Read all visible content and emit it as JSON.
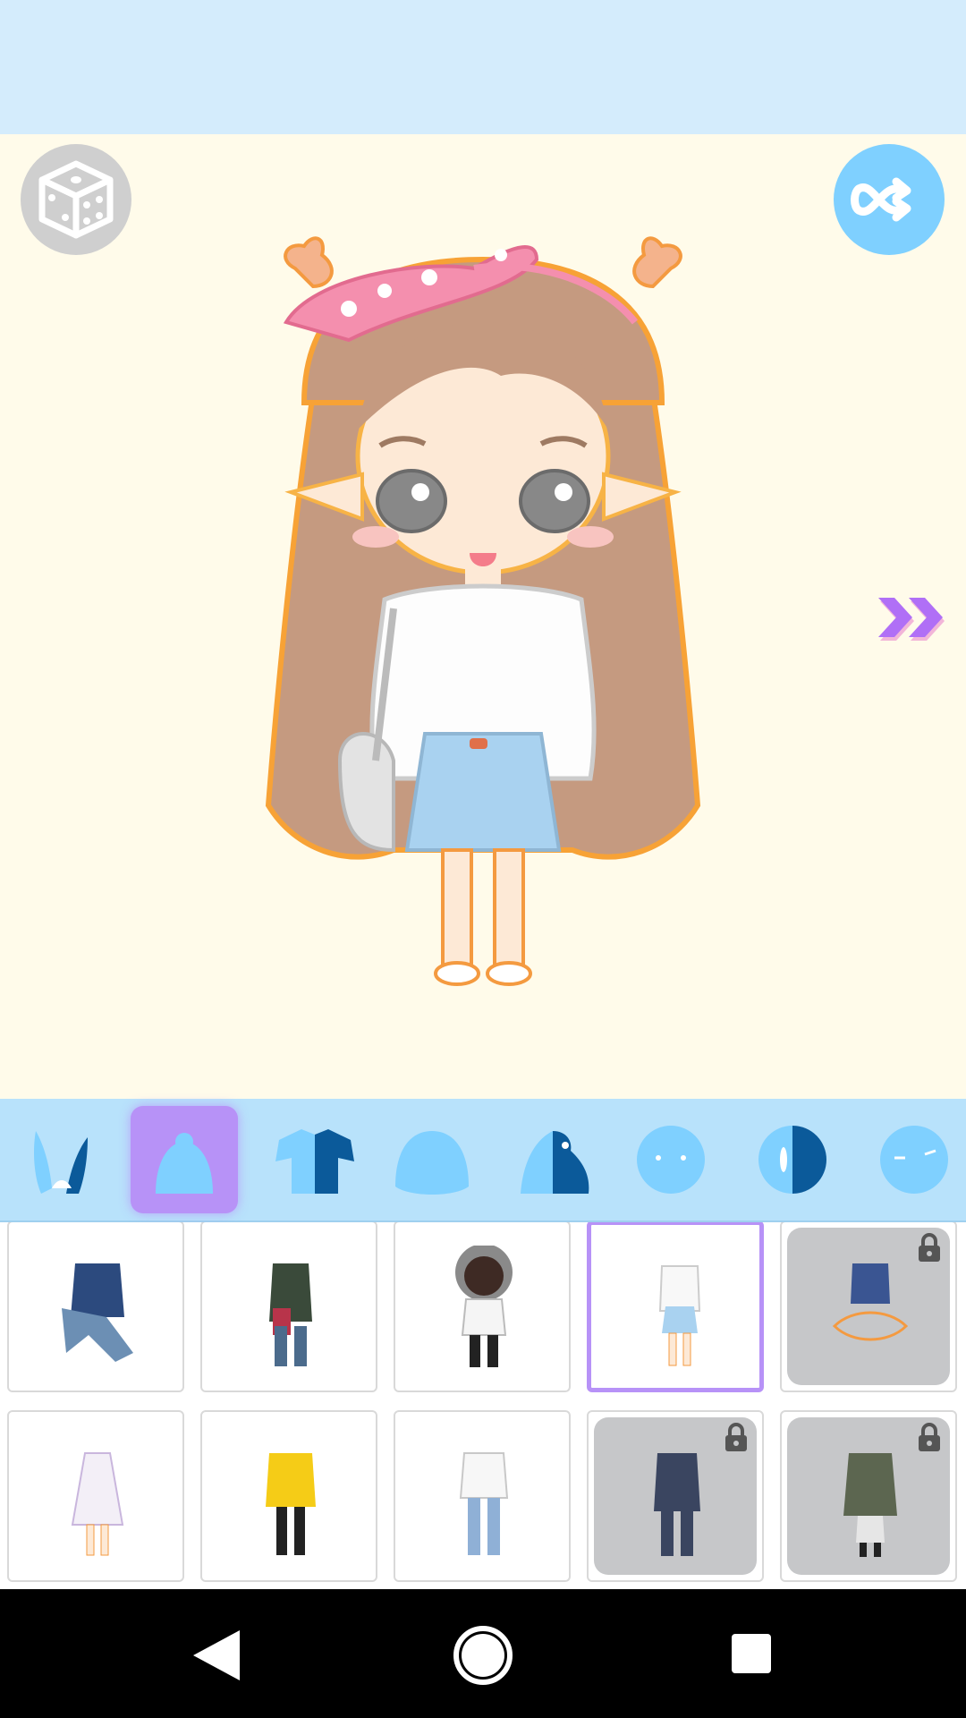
{
  "app": {
    "colors": {
      "top_bar": "#d4ecfc",
      "canvas": "#fffbea",
      "category_bar": "#b8e2fb",
      "accent_purple": "#b792f7",
      "icon_blue": "#7fd0ff",
      "locked_tile": "#c6c7c9"
    }
  },
  "controls": {
    "random_icon": "dice-icon",
    "shuffle_icon": "shuffle-icon",
    "next_icon": "double-chevron-right-icon"
  },
  "categories": [
    {
      "icon": "bunny-ears-icon",
      "active": false
    },
    {
      "icon": "body-icon",
      "active": true
    },
    {
      "icon": "shirt-icon",
      "active": false
    },
    {
      "icon": "hair-icon",
      "active": false
    },
    {
      "icon": "side-hair-icon",
      "active": false
    },
    {
      "icon": "face-icon",
      "active": false
    },
    {
      "icon": "half-face-icon",
      "active": false
    },
    {
      "icon": "eyes-face-icon",
      "active": false
    }
  ],
  "outfits": [
    {
      "icon": "outfit-denim-jacket-icon",
      "locked": false,
      "selected": false
    },
    {
      "icon": "outfit-plaid-jacket-icon",
      "locked": false,
      "selected": false
    },
    {
      "icon": "outfit-hoodie-icon",
      "locked": false,
      "selected": false
    },
    {
      "icon": "outfit-cardigan-skirt-icon",
      "locked": false,
      "selected": true
    },
    {
      "icon": "outfit-sitting-icon",
      "locked": true,
      "selected": false
    },
    {
      "icon": "outfit-floral-dress-icon",
      "locked": false,
      "selected": false
    },
    {
      "icon": "outfit-yellow-jacket-icon",
      "locked": false,
      "selected": false
    },
    {
      "icon": "outfit-white-top-jeans-icon",
      "locked": false,
      "selected": false
    },
    {
      "icon": "outfit-suit-icon",
      "locked": true,
      "selected": false
    },
    {
      "icon": "outfit-wrap-coat-icon",
      "locked": true,
      "selected": false
    }
  ],
  "system_nav": {
    "back_icon": "back-triangle-icon",
    "home_icon": "home-circle-icon",
    "recent_icon": "recent-square-icon"
  }
}
